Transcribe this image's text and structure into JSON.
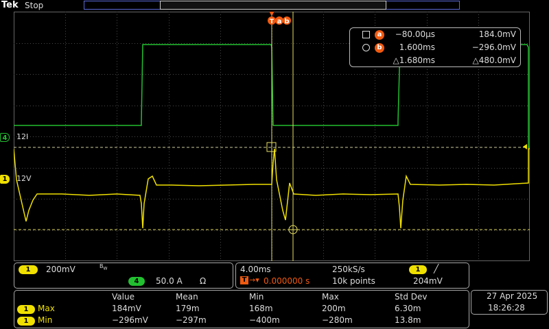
{
  "app": {
    "brand": "Tek",
    "acquisition_state": "Stop"
  },
  "trigger_marker": {
    "label": "T",
    "cursor_a_label": "a",
    "cursor_b_label": "b"
  },
  "cursors": {
    "a": {
      "time": "−80.00µs",
      "value": "184.0mV",
      "badge": "a"
    },
    "b": {
      "time": "1.600ms",
      "value": "−296.0mV",
      "badge": "b"
    },
    "delta": {
      "time": "△1.680ms",
      "value": "△480.0mV"
    }
  },
  "channels": {
    "ch1": {
      "number": "1",
      "trace_label": "12V",
      "scale": "200mV",
      "bw_icon": "bandwidth-limit-icon",
      "color": "#f0e000"
    },
    "ch4": {
      "number": "4",
      "trace_label": "12I",
      "scale": "50.0 A",
      "termination_icon": "ohm-icon",
      "color": "#22c030"
    }
  },
  "horizontal": {
    "timebase": "4.00ms",
    "sample_rate": "250kS/s",
    "record_length": "10k points",
    "trigger_delay": "0.000000 s",
    "trigger_source": "1",
    "trigger_slope_icon": "rising-edge-icon",
    "trigger_level": "204mV"
  },
  "measurements": {
    "columns": [
      "Value",
      "Mean",
      "Min",
      "Max",
      "Std Dev"
    ],
    "rows": [
      {
        "channel": "1",
        "name": "Max",
        "values": [
          "184mV",
          "179m",
          "168m",
          "200m",
          "6.30m"
        ]
      },
      {
        "channel": "1",
        "name": "Min",
        "values": [
          "−296mV",
          "−297m",
          "−400m",
          "−280m",
          "13.8m"
        ]
      }
    ]
  },
  "clock": {
    "date": "27 Apr  2025",
    "time": "18:26:28"
  },
  "colors": {
    "ch1": "#f0e000",
    "ch4": "#22c030",
    "cursor_badge": "#f05a10",
    "grid": "#555555"
  }
}
